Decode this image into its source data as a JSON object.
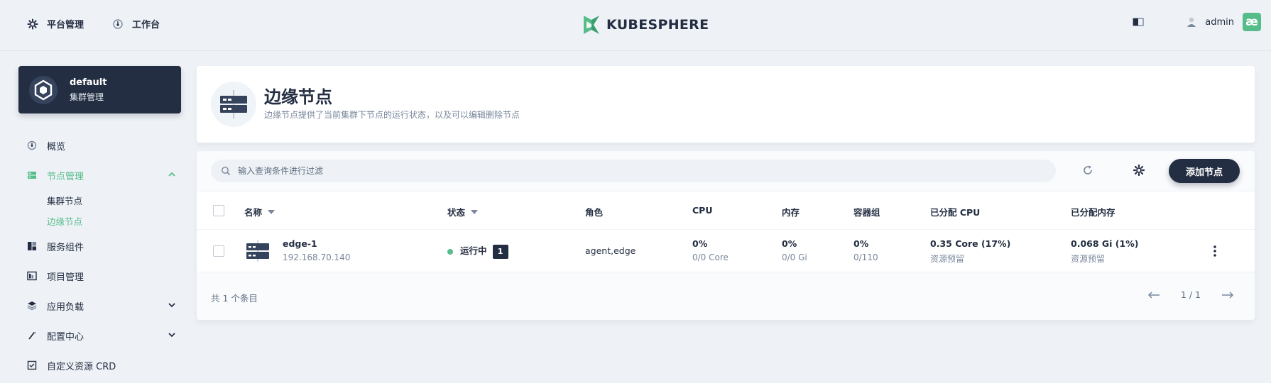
{
  "topbar": {
    "nav": [
      {
        "label": "平台管理",
        "icon": "gear-icon"
      },
      {
        "label": "工作台",
        "icon": "dashboard-icon"
      }
    ],
    "brand": "KUBESPHERE",
    "user": "admin",
    "avatar_text": "æ"
  },
  "sidebar": {
    "cluster": {
      "name": "default",
      "subtitle": "集群管理"
    },
    "items": [
      {
        "label": "概览",
        "icon": "overview-icon"
      },
      {
        "label": "节点管理",
        "icon": "node-icon",
        "active": true,
        "expanded": true,
        "children": [
          {
            "label": "集群节点"
          },
          {
            "label": "边缘节点",
            "active": true
          }
        ]
      },
      {
        "label": "服务组件",
        "icon": "components-icon"
      },
      {
        "label": "项目管理",
        "icon": "project-icon"
      },
      {
        "label": "应用负载",
        "icon": "workload-icon",
        "collapsible": true
      },
      {
        "label": "配置中心",
        "icon": "config-icon",
        "collapsible": true
      },
      {
        "label": "自定义资源 CRD",
        "icon": "crd-icon"
      }
    ]
  },
  "header": {
    "title": "边缘节点",
    "description": "边缘节点提供了当前集群下节点的运行状态，以及可以编辑删除节点"
  },
  "toolbar": {
    "search_placeholder": "输入查询条件进行过滤",
    "add_label": "添加节点"
  },
  "table": {
    "columns": [
      "名称",
      "状态",
      "角色",
      "CPU",
      "内存",
      "容器组",
      "已分配 CPU",
      "已分配内存"
    ],
    "rows": [
      {
        "name": "edge-1",
        "ip": "192.168.70.140",
        "status": "运行中",
        "badge": "1",
        "role": "agent,edge",
        "cpu": "0%",
        "cpu_sub": "0/0 Core",
        "memory": "0%",
        "memory_sub": "0/0 Gi",
        "pods": "0%",
        "pods_sub": "0/110",
        "alloc_cpu": "0.35 Core (17%)",
        "alloc_cpu_sub": "资源预留",
        "alloc_mem": "0.068 Gi (1%)",
        "alloc_mem_sub": "资源预留"
      }
    ],
    "total": "共 1 个条目",
    "page": "1 / 1"
  },
  "colors": {
    "accent": "#55bc8a",
    "dark": "#242e42",
    "background": "#eef2f6"
  }
}
